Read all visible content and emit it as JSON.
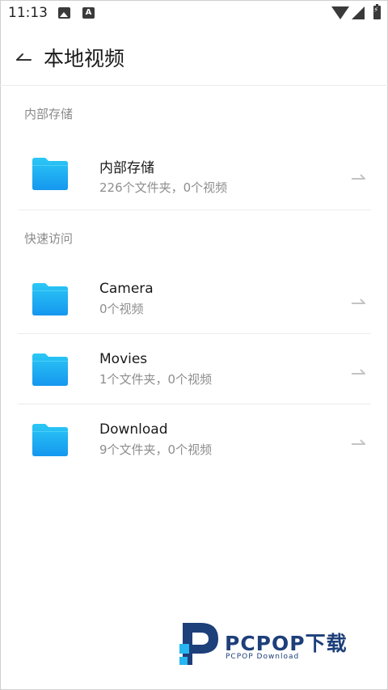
{
  "status_bar": {
    "time": "11:13",
    "icons": [
      "photo-icon",
      "a-icon",
      "wifi-icon",
      "signal-icon",
      "battery-charging-icon"
    ]
  },
  "header": {
    "title": "本地视频",
    "back_icon": "back-arrow-icon"
  },
  "sections": [
    {
      "label": "内部存储",
      "items": [
        {
          "title": "内部存储",
          "subtitle": "226个文件夹，0个视频"
        }
      ]
    },
    {
      "label": "快速访问",
      "items": [
        {
          "title": "Camera",
          "subtitle": "0个视频"
        },
        {
          "title": "Movies",
          "subtitle": "1个文件夹，0个视频"
        },
        {
          "title": "Download",
          "subtitle": "9个文件夹，0个视频"
        }
      ]
    }
  ],
  "colors": {
    "folder_top": "#2bc8f5",
    "folder_bottom": "#1597ef",
    "divider": "#ececec",
    "secondary_text": "#8e8e8e",
    "watermark": "#1d3f7a"
  },
  "watermark": {
    "brand": "PCPOP下载",
    "sub": "PCPOP Download"
  }
}
